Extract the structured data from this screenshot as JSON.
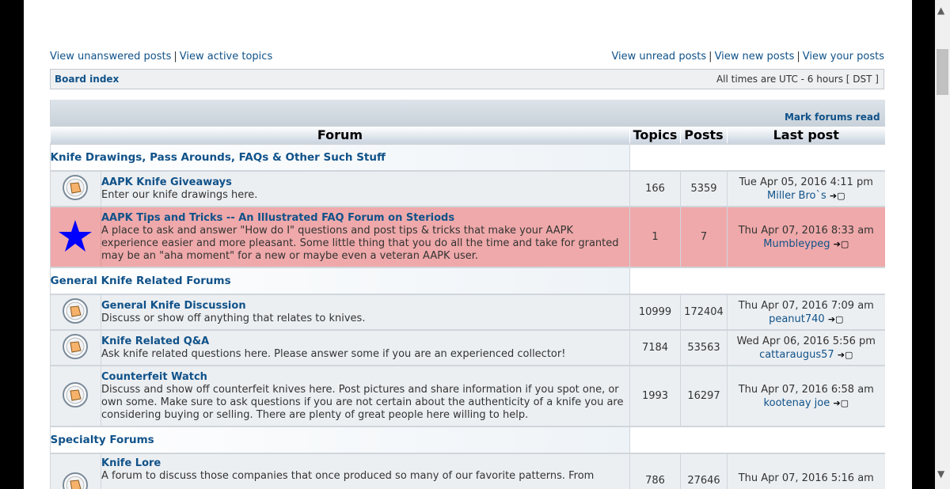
{
  "toplinks": {
    "unanswered": "View unanswered posts",
    "active": "View active topics",
    "unread": "View unread posts",
    "new": "View new posts",
    "yours": "View your posts",
    "separator": "|"
  },
  "navbar": {
    "crumb": "Board index",
    "timezone": "All times are UTC - 6 hours [ DST ]"
  },
  "table": {
    "mark_read": "Mark forums read",
    "headers": {
      "forum": "Forum",
      "topics": "Topics",
      "posts": "Posts",
      "last_post": "Last post"
    }
  },
  "categories": [
    {
      "name": "Knife Drawings, Pass Arounds, FAQs & Other Such Stuff"
    },
    {
      "name": "General Knife Related Forums"
    },
    {
      "name": "Specialty Forums"
    }
  ],
  "forums": [
    {
      "title": "AAPK Knife Giveaways",
      "desc": "Enter our knife drawings here.",
      "topics": "166",
      "posts": "5359",
      "last_date": "Tue Apr 05, 2016 4:11 pm",
      "last_user": "Miller Bro`s"
    },
    {
      "title": "AAPK Tips and Tricks -- An Illustrated FAQ Forum on Steriods",
      "desc": "A place to ask and answer \"How do I\" questions and post tips & tricks that make your AAPK experience easier and more pleasant. Some little thing that you do all the time and take for granted may be an \"aha moment\" for a new or maybe even a veteran AAPK user.",
      "topics": "1",
      "posts": "7",
      "last_date": "Thu Apr 07, 2016 8:33 am",
      "last_user": "Mumbleypeg"
    },
    {
      "title": "General Knife Discussion",
      "desc": "Discuss or show off anything that relates to knives.",
      "topics": "10999",
      "posts": "172404",
      "last_date": "Thu Apr 07, 2016 7:09 am",
      "last_user": "peanut740"
    },
    {
      "title": "Knife Related Q&A",
      "desc": "Ask knife related questions here. Please answer some if you are an experienced collector!",
      "topics": "7184",
      "posts": "53563",
      "last_date": "Wed Apr 06, 2016 5:56 pm",
      "last_user": "cattaraugus57"
    },
    {
      "title": "Counterfeit Watch",
      "desc": "Discuss and show off counterfeit knives here. Post pictures and share information if you spot one, or own some. Make sure to ask questions if you are not certain about the authenticity of a knife you are considering buying or selling. There are plenty of great people here willing to help.",
      "topics": "1993",
      "posts": "16297",
      "last_date": "Thu Apr 07, 2016 6:58 am",
      "last_user": "kootenay joe"
    },
    {
      "title": "Knife Lore",
      "desc": "A forum to discuss those companies that once produced so many of our favorite patterns. From",
      "topics": "786",
      "posts": "27646",
      "last_date": "Thu Apr 07, 2016 5:16 am",
      "last_user": ""
    }
  ],
  "goto_icon": "view-latest-post-icon",
  "colors": {
    "link": "#105289",
    "highlight_row": "#efa9aa",
    "star": "#0000ff"
  }
}
